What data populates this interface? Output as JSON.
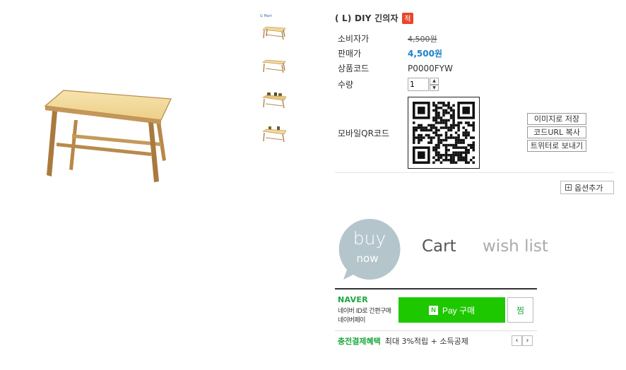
{
  "product": {
    "title": "( L) DIY 긴의자",
    "badge": "적",
    "thumb_label": "G Mart"
  },
  "info": {
    "consumer_price_label": "소비자가",
    "consumer_price": "4,500원",
    "sale_price_label": "판매가",
    "sale_price": "4,500원",
    "code_label": "상품코드",
    "code": "P0000FYW",
    "qty_label": "수량",
    "qty_value": "1",
    "qr_label": "모바일QR코드"
  },
  "side_buttons": {
    "save_image": "이미지로 저장",
    "copy_url": "코드URL 복사",
    "twitter": "트위터로 보내기"
  },
  "option_add": "옵션추가",
  "actions": {
    "buy": "buy",
    "now": "now",
    "cart": "Cart",
    "wish": "wish list"
  },
  "naver": {
    "logo": "NAVER",
    "desc1": "네이버 ID로 간편구매",
    "desc2": "네이버페이",
    "pay_label": "Pay 구매",
    "n_mark": "N",
    "jjim": "찜",
    "benefit_label": "충전결제혜택",
    "benefit_text": "최대 3%적립 + 소득공제",
    "prev": "‹",
    "next": "›"
  },
  "colors": {
    "sale_blue": "#1e82c9",
    "naver_green": "#1ec800",
    "bubble_gray": "#b4c6cc",
    "badge_red": "#e8462a"
  }
}
